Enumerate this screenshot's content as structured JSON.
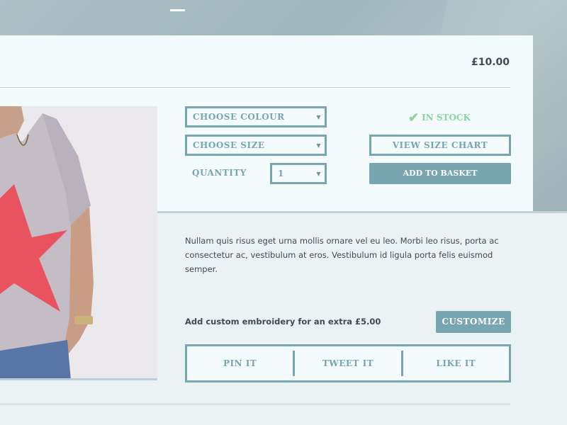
{
  "product": {
    "price": "£10.00"
  },
  "options": {
    "colour_label": "CHOOSE COLOUR",
    "size_label": "CHOOSE SIZE",
    "quantity_label": "QUANTITY",
    "quantity_value": "1"
  },
  "stock": {
    "status": "IN STOCK",
    "color": "#8ad3a1"
  },
  "actions": {
    "size_chart_label": "VIEW SIZE CHART",
    "add_to_basket_label": "ADD TO BASKET"
  },
  "description": "Nullam quis risus eget urna mollis ornare vel eu leo. Morbi leo risus, porta ac consectetur ac, vestibulum at eros. Vestibulum id ligula porta felis euismod semper.",
  "embroidery": {
    "text": "Add custom embroidery for an extra £5.00",
    "button_label": "CUSTOMIZE"
  },
  "social": {
    "pin_label": "PIN IT",
    "tweet_label": "TWEET IT",
    "like_label": "LIKE IT"
  },
  "theme": {
    "accent": "#77a5b0",
    "text": "#3e4c55"
  }
}
